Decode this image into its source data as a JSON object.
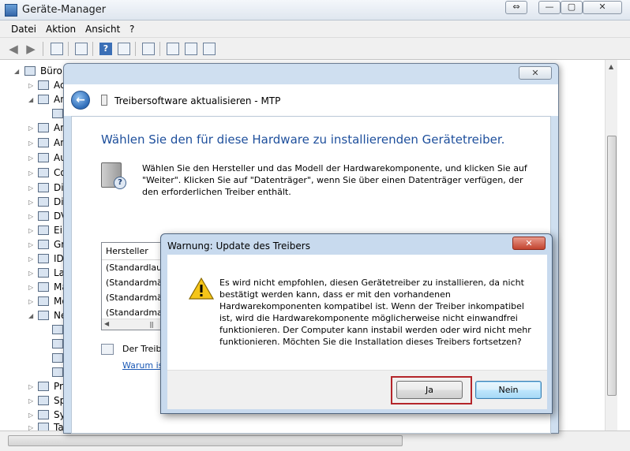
{
  "window": {
    "title": "Geräte-Manager",
    "caption_swap": "⇔",
    "caption_min": "—",
    "caption_max": "▢",
    "caption_close": "✕"
  },
  "menu": {
    "items": [
      "Datei",
      "Aktion",
      "Ansicht",
      "?"
    ]
  },
  "tree": {
    "root": "Büro",
    "partial_labels": [
      "Ac",
      "An",
      "An",
      "An",
      "Au",
      "Co",
      "Dis",
      "Dis",
      "DV",
      "Ein",
      "Gr",
      "IDI",
      "La",
      "Mä",
      "Mo",
      "Ne",
      "Pr",
      "Sp",
      "Sy",
      "Tas"
    ]
  },
  "wizard": {
    "close": "✕",
    "title": "Treibersoftware aktualisieren - MTP",
    "heading": "Wählen Sie den für diese Hardware zu installierenden Gerätetreiber.",
    "description": "Wählen Sie den Hersteller und das Modell der Hardwarekomponente, und klicken Sie auf \"Weiter\". Klicken Sie auf \"Datenträger\", wenn Sie über einen Datenträger verfügen, der den erforderlichen Treiber enthält.",
    "list_header": "Hersteller",
    "list_rows": [
      "(Standardlauf",
      "(Standardmä",
      "(Standardmä",
      "(Standardma"
    ],
    "signed_text": "Der Treib",
    "signed_link": "Warum is"
  },
  "warning": {
    "title": "Warnung: Update des Treibers",
    "close": "✕",
    "message": "Es wird nicht empfohlen, diesen Gerätetreiber zu installieren, da nicht\nbestätigt werden kann, dass er mit den vorhandenen\nHardwarekomponenten kompatibel ist.  Wenn der Treiber inkompatibel\nist, wird die Hardwarekomponente möglicherweise nicht einwandfrei\nfunktionieren. Der Computer kann instabil werden oder wird nicht mehr\nfunktionieren.  Möchten Sie die Installation dieses Treibers fortsetzen?",
    "yes_label": "Ja",
    "no_label": "Nein"
  },
  "colors": {
    "heading_blue": "#1e4f9c",
    "highlight_red": "#b4252a"
  }
}
